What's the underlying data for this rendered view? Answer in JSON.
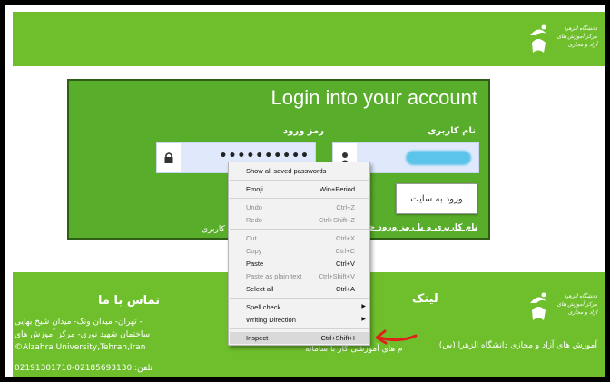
{
  "header": {
    "logo_alt": "Alzahra University logo"
  },
  "login": {
    "title": "Login into your account",
    "username_label": "نام کاربری",
    "password_label": "رمز ورود",
    "password_value": "••••••••••",
    "submit_label": "ورود به سایت",
    "recover_link": "نام کاربری و یا رمز ورود خود را",
    "remember_text": "م کاربری",
    "user_icon": "person-icon",
    "lock_icon": "lock-icon"
  },
  "context_menu": {
    "items": [
      {
        "label": "Show all saved passwords",
        "shortcut": "",
        "disabled": false
      },
      {
        "label": "Emoji",
        "shortcut": "Win+Period",
        "disabled": false
      },
      {
        "label": "Undo",
        "shortcut": "Ctrl+Z",
        "disabled": true
      },
      {
        "label": "Redo",
        "shortcut": "Ctrl+Shift+Z",
        "disabled": true
      },
      {
        "label": "Cut",
        "shortcut": "Ctrl+X",
        "disabled": true
      },
      {
        "label": "Copy",
        "shortcut": "Ctrl+C",
        "disabled": true
      },
      {
        "label": "Paste",
        "shortcut": "Ctrl+V",
        "disabled": false
      },
      {
        "label": "Paste as plain text",
        "shortcut": "Ctrl+Shift+V",
        "disabled": true
      },
      {
        "label": "Select all",
        "shortcut": "Ctrl+A",
        "disabled": false
      },
      {
        "label": "Spell check",
        "shortcut": "",
        "disabled": false
      },
      {
        "label": "Writing Direction",
        "shortcut": "",
        "disabled": false
      },
      {
        "label": "Inspect",
        "shortcut": "Ctrl+Shift+I",
        "disabled": false
      }
    ]
  },
  "footer": {
    "contact_title": "تماس با ما",
    "contact_lines": [
      "تهران- میدان ونک- میدان شیخ بهایی -",
      "ساختمان شهید نوری- مرکز آموزش های",
      "©Alzahra University,Tehran,Iran",
      "تلفن: 02185693130-02191301710"
    ],
    "links_title": "لینک",
    "links_item": "م های آموزشی کار با سامانه",
    "description": "آموزش های آزاد و مجازی دانشگاه الزهرا (س)"
  },
  "colors": {
    "brand_green": "#6fbf2d",
    "card_green": "#58ad2a",
    "annotation_red": "#e0201b"
  }
}
